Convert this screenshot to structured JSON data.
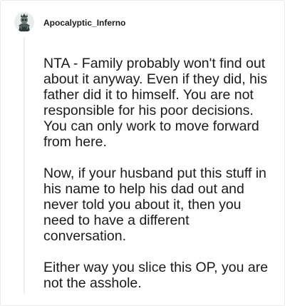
{
  "comment": {
    "username": "Apocalyptic_Inferno",
    "paragraphs": [
      "NTA - Family probably won't find out about it anyway. Even if they did, his father did it to himself. You are not responsible for his poor decisions. You can only work to move forward from here.",
      "Now, if your husband put this stuff in his name to help his dad out and never told you about it, then you need to have a different conversation.",
      "Either way you slice this OP, you are not the asshole."
    ]
  },
  "icons": {
    "avatar": "skull-warrior-avatar-icon"
  },
  "colors": {
    "text": "#1a1a1b",
    "thread_line": "#edeff1",
    "background": "#ffffff"
  }
}
